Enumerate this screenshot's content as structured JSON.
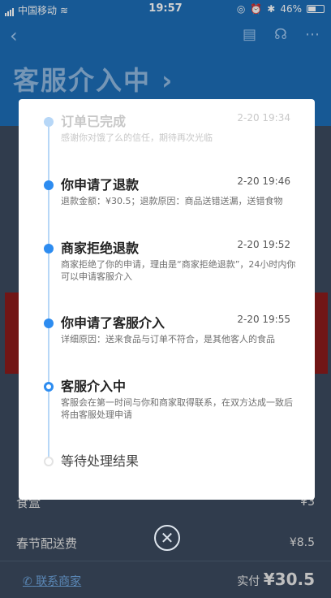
{
  "status_bar": {
    "carrier": "中国移动",
    "time": "19:57",
    "battery": "46%"
  },
  "header": {
    "title": "客服介入中",
    "title_arrow": "›"
  },
  "background_rows": [
    {
      "label": "食盒",
      "price": "¥3"
    },
    {
      "label": "春节配送费",
      "price": "¥8.5"
    }
  ],
  "footer": {
    "contact": "联系商家",
    "paid_label": "实付",
    "paid_amount": "¥30.5"
  },
  "timeline": [
    {
      "title": "订单已完成",
      "time": "2-20 19:34",
      "desc": "感谢你对饿了么的信任，期待再次光临",
      "state": "faded"
    },
    {
      "title": "你申请了退款",
      "time": "2-20 19:46",
      "desc": "退款金额：¥30.5；退款原因：商品送错送漏，送错食物",
      "state": "done"
    },
    {
      "title": "商家拒绝退款",
      "time": "2-20 19:52",
      "desc": "商家拒绝了你的申请，理由是“商家拒绝退款”，24小时内你可以申请客服介入",
      "state": "done"
    },
    {
      "title": "你申请了客服介入",
      "time": "2-20 19:55",
      "desc": "详细原因：送来食品与订单不符合，是其他客人的食品",
      "state": "done"
    },
    {
      "title": "客服介入中",
      "time": "",
      "desc": "客服会在第一时间与你和商家取得联系，在双方达成一致后将由客服处理申请",
      "state": "current"
    },
    {
      "title": "等待处理结果",
      "time": "",
      "desc": "",
      "state": "pending"
    }
  ],
  "colors": {
    "accent": "#2d8cf0",
    "header_bg": "#1d6db6"
  }
}
